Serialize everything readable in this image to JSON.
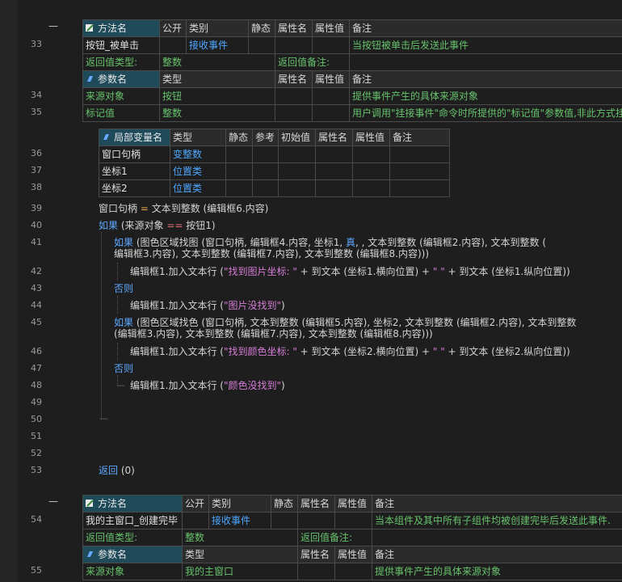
{
  "line_numbers": {
    "l33": "33",
    "l34": "34",
    "l35": "35",
    "l36": "36",
    "l37": "37",
    "l38": "38",
    "l39": "39",
    "l40": "40",
    "l41": "41",
    "l42": "42",
    "l43": "43",
    "l44": "44",
    "l45": "45",
    "l46": "46",
    "l47": "47",
    "l48": "48",
    "l49": "49",
    "l50": "50",
    "l51": "51",
    "l52": "52",
    "l53": "53",
    "l54": "54",
    "l55": "55"
  },
  "method1": {
    "header": {
      "name": "方法名",
      "public": "公开",
      "category": "类别",
      "static": "静态",
      "attr_name": "属性名",
      "attr_value": "属性值",
      "note": "备注"
    },
    "row": {
      "name": "按钮_被单击",
      "category": "接收事件",
      "note": "当按钮被单击后发送此事件"
    },
    "return_label": "返回值类型:",
    "return_type": "整数",
    "return_note_label": "返回值备注:",
    "param_header": {
      "name": "参数名",
      "type": "类型",
      "attr_name": "属性名",
      "attr_value": "属性值",
      "note": "备注"
    },
    "params": [
      {
        "name": "来源对象",
        "type": "按钮",
        "note": "提供事件产生的具体来源对象"
      },
      {
        "name": "标记值",
        "type": "整数",
        "note": "用户调用\"挂接事件\"命令时所提供的\"标记值\"参数值,非此方式挂"
      }
    ]
  },
  "locals": {
    "header": {
      "name": "局部变量名",
      "type": "类型",
      "static": "静态",
      "ref": "参考",
      "init": "初始值",
      "attr_name": "属性名",
      "attr_value": "属性值",
      "note": "备注"
    },
    "rows": [
      {
        "name": "窗口句柄",
        "type": "变整数"
      },
      {
        "name": "坐标1",
        "type": "位置类"
      },
      {
        "name": "坐标2",
        "type": "位置类"
      }
    ]
  },
  "code": {
    "l39": {
      "a": "窗口句柄 ",
      "op": "= ",
      "b": "文本到整数 (编辑框6.内容)"
    },
    "l40": {
      "kw": "如果",
      "a": " (来源对象 ",
      "op": "== ",
      "b": "按钮1)"
    },
    "l41a": {
      "kw": "如果",
      "a": " (图色区域找图 (窗口句柄, 编辑框4.内容, 坐标1, ",
      "kw2": "真",
      "b": ", , 文本到整数 (编辑框2.内容), 文本到整数 ("
    },
    "l41b": "编辑框3.内容), 文本到整数 (编辑框7.内容), 文本到整数 (编辑框8.内容)))",
    "l42": {
      "a": "编辑框1.加入文本行 (",
      "s1": "\"找到图片坐标: \"",
      "b": " + 到文本 (坐标1.横向位置) + ",
      "s2": "\"      \"",
      "c": " + 到文本 (坐标1.纵向位置))"
    },
    "l43": "否则",
    "l44": {
      "a": "编辑框1.加入文本行 (",
      "s": "\"图片没找到\"",
      "b": ")"
    },
    "l45a": {
      "kw": "如果",
      "a": " (图色区域找色 (窗口句柄, 文本到整数 (编辑框5.内容), 坐标2, 文本到整数 (编辑框2.内容), 文本到整数"
    },
    "l45b": "(编辑框3.内容), 文本到整数 (编辑框7.内容), 文本到整数 (编辑框8.内容)))",
    "l46": {
      "a": "编辑框1.加入文本行 (",
      "s1": "\"找到颜色坐标: \"",
      "b": " + 到文本 (坐标2.横向位置) + ",
      "s2": "\"      \"",
      "c": " + 到文本 (坐标2.纵向位置))"
    },
    "l47": "否则",
    "l48": {
      "a": "编辑框1.加入文本行 (",
      "s": "\"颜色没找到\"",
      "b": ")"
    },
    "l53": {
      "kw": "返回",
      "a": " (0)"
    }
  },
  "method2": {
    "header": {
      "name": "方法名",
      "public": "公开",
      "category": "类别",
      "static": "静态",
      "attr_name": "属性名",
      "attr_value": "属性值",
      "note": "备注"
    },
    "row": {
      "name": "我的主窗口_创建完毕",
      "category": "接收事件",
      "note": "当本组件及其中所有子组件均被创建完毕后发送此事件."
    },
    "return_label": "返回值类型:",
    "return_type": "整数",
    "return_note_label": "返回值备注:",
    "param_header": {
      "name": "参数名",
      "type": "类型",
      "attr_name": "属性名",
      "attr_value": "属性值",
      "note": "备注"
    },
    "params": [
      {
        "name": "来源对象",
        "type": "我的主窗口",
        "note": "提供事件产生的具体来源对象"
      }
    ]
  },
  "colors": {
    "background": "#1e1e1e",
    "keyword": "#5fa8ff",
    "string": "#d67cd6",
    "type_blue": "#4ea6ff",
    "note_green": "#67c26c",
    "header_accent": "#1f4a5a"
  }
}
